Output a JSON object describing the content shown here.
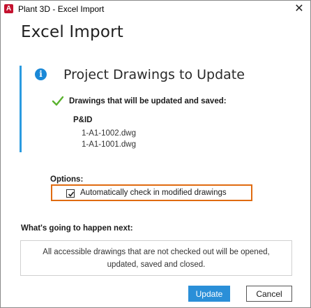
{
  "window": {
    "title": "Plant 3D - Excel Import",
    "app_icon_letter": "A",
    "close_glyph": "✕"
  },
  "heading": "Excel Import",
  "section": {
    "info_glyph": "i",
    "title": "Project Drawings to Update",
    "updated_label": "Drawings that will be updated and saved:",
    "group_name": "P&ID",
    "drawings": [
      "1-A1-1002.dwg",
      "1-A1-1001.dwg"
    ]
  },
  "options": {
    "label": "Options:",
    "checkin_label": "Automatically check in modified drawings",
    "checkin_checked": true
  },
  "next": {
    "label": "What's going to happen next:",
    "description": "All accessible drawings that are not checked out will be opened, updated, saved and closed."
  },
  "buttons": {
    "update": "Update",
    "cancel": "Cancel"
  },
  "colors": {
    "accent_blue": "#2a8fd8",
    "section_bar": "#2b9be0",
    "highlight_orange": "#e06b10",
    "check_green": "#5ab22e",
    "app_red": "#c4122f"
  },
  "icons": {
    "app": "autocad-plant3d-icon",
    "info": "info-icon",
    "check": "checkmark-icon",
    "close": "close-icon"
  }
}
